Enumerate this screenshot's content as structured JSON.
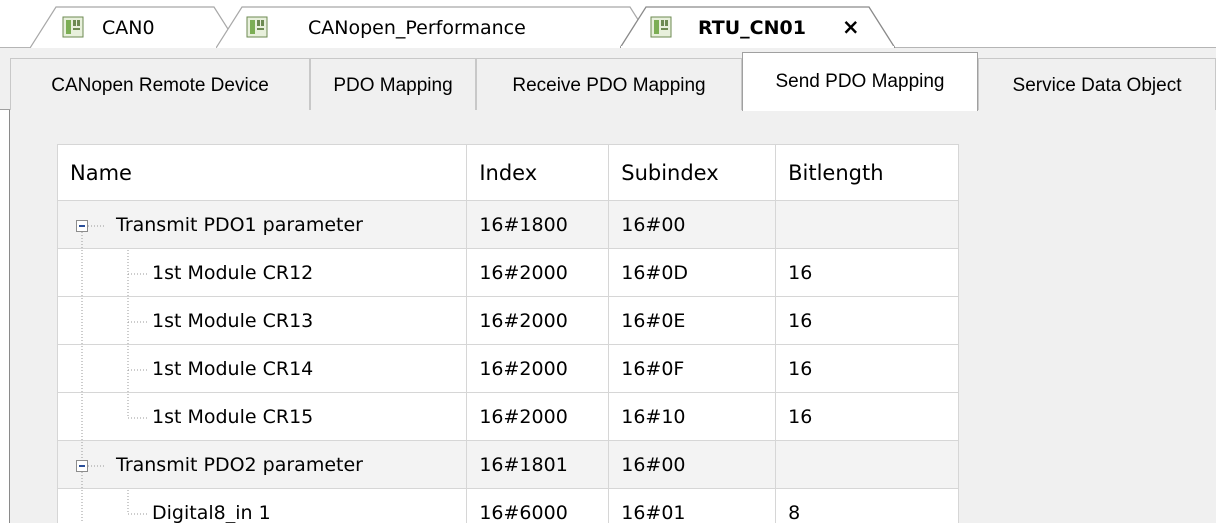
{
  "editor_tabs": [
    {
      "label": "CAN0",
      "active": false
    },
    {
      "label": "CANopen_Performance",
      "active": false
    },
    {
      "label": "RTU_CN01",
      "active": true,
      "close": "×"
    }
  ],
  "sub_tabs": [
    {
      "label": "CANopen Remote Device",
      "active": false
    },
    {
      "label": "PDO Mapping",
      "active": false
    },
    {
      "label": "Receive PDO Mapping",
      "active": false
    },
    {
      "label": "Send PDO Mapping",
      "active": true
    },
    {
      "label": "Service Data Object",
      "active": false
    }
  ],
  "table": {
    "columns": [
      "Name",
      "Index",
      "Subindex",
      "Bitlength"
    ],
    "rows": [
      {
        "type": "group",
        "name": "Transmit PDO1 parameter",
        "index": "16#1800",
        "subindex": "16#00",
        "bitlength": ""
      },
      {
        "type": "child",
        "name": "1st Module CR12",
        "index": "16#2000",
        "subindex": "16#0D",
        "bitlength": "16"
      },
      {
        "type": "child",
        "name": "1st Module CR13",
        "index": "16#2000",
        "subindex": "16#0E",
        "bitlength": "16"
      },
      {
        "type": "child",
        "name": "1st Module CR14",
        "index": "16#2000",
        "subindex": "16#0F",
        "bitlength": "16"
      },
      {
        "type": "child-last",
        "name": "1st Module CR15",
        "index": "16#2000",
        "subindex": "16#10",
        "bitlength": "16"
      },
      {
        "type": "group",
        "name": "Transmit PDO2 parameter",
        "index": "16#1801",
        "subindex": "16#00",
        "bitlength": ""
      },
      {
        "type": "child-last",
        "name": "Digital8_in 1",
        "index": "16#6000",
        "subindex": "16#01",
        "bitlength": "8"
      }
    ]
  },
  "icons": {
    "device": "device-icon",
    "collapse": "collapse-minus-icon",
    "close": "close-icon"
  },
  "colors": {
    "tab_strip_bg": "#f0f0f0",
    "group_row_bg": "#f3f3f3",
    "grid_line": "#d6d6d6",
    "device_icon_green": "#7cae55"
  }
}
